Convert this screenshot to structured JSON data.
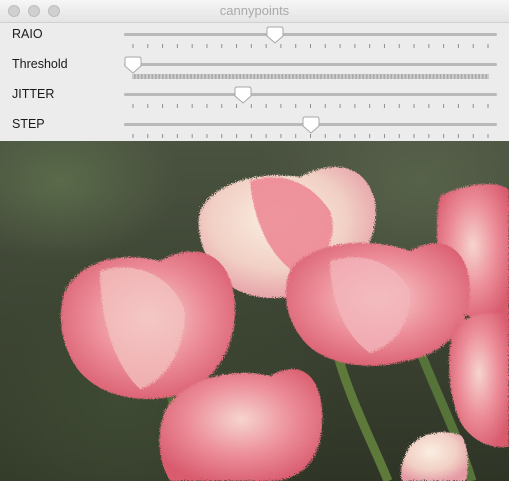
{
  "window": {
    "title": "cannypoints"
  },
  "controls": [
    {
      "label": "RAIO",
      "value_fraction": 0.4,
      "tick_count": 25
    },
    {
      "label": "Threshold",
      "value_fraction": 0.0,
      "tick_count": 255
    },
    {
      "label": "JITTER",
      "value_fraction": 0.31,
      "tick_count": 25
    },
    {
      "label": "STEP",
      "value_fraction": 0.5,
      "tick_count": 25
    }
  ],
  "colors": {
    "track": "#b9b9b9",
    "tick": "#8e8e8e",
    "thumb_fill": "#ffffff",
    "thumb_border": "#a7a7a7",
    "petal_pink": "#e8717f",
    "petal_light": "#f4d9cf",
    "stem_green": "#5d7a3a"
  },
  "icons": [
    "close-icon",
    "minimize-icon",
    "zoom-icon",
    "slider-thumb-icon"
  ]
}
